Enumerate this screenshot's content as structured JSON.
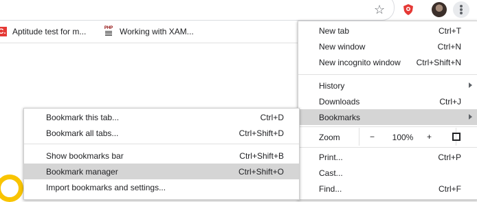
{
  "toolbar": {
    "star_icon": "star-icon",
    "extension_icon": "shield-extension-icon",
    "avatar_icon": "profile-avatar",
    "menu_icon": "more-vert-icon"
  },
  "bookmarks_bar": {
    "items": [
      {
        "favicon_text": "C.",
        "label": "Aptitude test for m..."
      },
      {
        "favicon_text": "PHP",
        "label": "Working with XAM..."
      }
    ]
  },
  "main_menu": {
    "new_tab": {
      "label": "New tab",
      "shortcut": "Ctrl+T"
    },
    "new_window": {
      "label": "New window",
      "shortcut": "Ctrl+N"
    },
    "new_incognito": {
      "label": "New incognito window",
      "shortcut": "Ctrl+Shift+N"
    },
    "history": {
      "label": "History"
    },
    "downloads": {
      "label": "Downloads",
      "shortcut": "Ctrl+J"
    },
    "bookmarks": {
      "label": "Bookmarks"
    },
    "zoom": {
      "label": "Zoom",
      "minus": "−",
      "value": "100%",
      "plus": "+"
    },
    "print": {
      "label": "Print...",
      "shortcut": "Ctrl+P"
    },
    "cast": {
      "label": "Cast..."
    },
    "find": {
      "label": "Find...",
      "shortcut": "Ctrl+F"
    }
  },
  "bookmarks_submenu": {
    "bookmark_tab": {
      "label": "Bookmark this tab...",
      "shortcut": "Ctrl+D"
    },
    "bookmark_all": {
      "label": "Bookmark all tabs...",
      "shortcut": "Ctrl+Shift+D"
    },
    "show_bar": {
      "label": "Show bookmarks bar",
      "shortcut": "Ctrl+Shift+B"
    },
    "manager": {
      "label": "Bookmark manager",
      "shortcut": "Ctrl+Shift+O"
    },
    "import": {
      "label": "Import bookmarks and settings..."
    }
  },
  "colors": {
    "accent_red": "#e53935",
    "ring_yellow": "#f9c400",
    "highlight": "#d5d5d5"
  }
}
